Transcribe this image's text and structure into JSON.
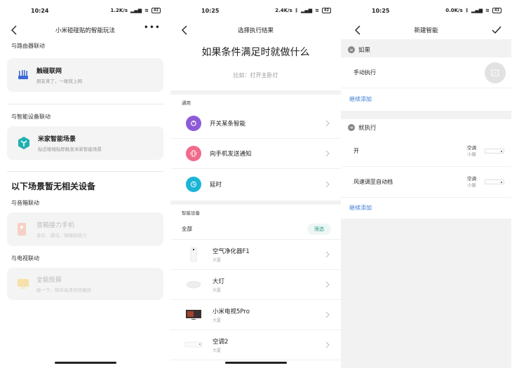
{
  "screen1": {
    "status": {
      "time": "10:24",
      "speed": "1.2K/s",
      "battery": "42"
    },
    "nav_title": "小米碰碰贴的智能玩法",
    "router_section": "与路由器联动",
    "router_card": {
      "title": "触碰联网",
      "sub": "朋友来了，一碰就上网"
    },
    "smart_section": "与智能设备联动",
    "smart_card": {
      "title": "米家智能场景",
      "sub": "贴近碰碰贴即触发米家智能场景"
    },
    "no_device_heading": "以下场景暂无相关设备",
    "speaker_section": "与音箱联动",
    "speaker_card": {
      "title": "音箱接力手机",
      "sub": "音乐、通话，弹碰贴接力"
    },
    "tv_section": "与电视联动",
    "tv_card": {
      "title": "全能投屏",
      "sub": "碰一下，畅享高清视频播放"
    }
  },
  "screen2": {
    "status": {
      "time": "10:25",
      "speed": "2.4K/s",
      "battery": "42"
    },
    "nav_title": "选择执行结果",
    "headline": "如果条件满足时就做什么",
    "hint": "比如：打开主卧灯",
    "general_label": "通用",
    "actions": [
      {
        "label": "开关某条智能",
        "color": "#8e5bd8"
      },
      {
        "label": "向手机发送通知",
        "color": "#f06b8a"
      },
      {
        "label": "延时",
        "color": "#1bb5d6"
      }
    ],
    "devices_label": "智能设备",
    "all_label": "全部",
    "filter_label": "筛选",
    "devices": [
      {
        "name": "空气净化器F1",
        "room": "大厦"
      },
      {
        "name": "大灯",
        "room": "大厦"
      },
      {
        "name": "小米电视5Pro",
        "room": "大厦"
      },
      {
        "name": "空调2",
        "room": "大厦"
      }
    ]
  },
  "screen3": {
    "status": {
      "time": "10:25",
      "speed": "0.0K/s",
      "battery": "41"
    },
    "nav_title": "新建智能",
    "if_label": "如果",
    "if_row": "手动执行",
    "add_more_1": "继续添加",
    "then_label": "就执行",
    "then_rows": [
      {
        "label": "开",
        "device": "空调",
        "room": "小屋"
      },
      {
        "label": "风速调至自动档",
        "device": "空调",
        "room": "小屋"
      }
    ],
    "add_more_2": "继续添加"
  }
}
